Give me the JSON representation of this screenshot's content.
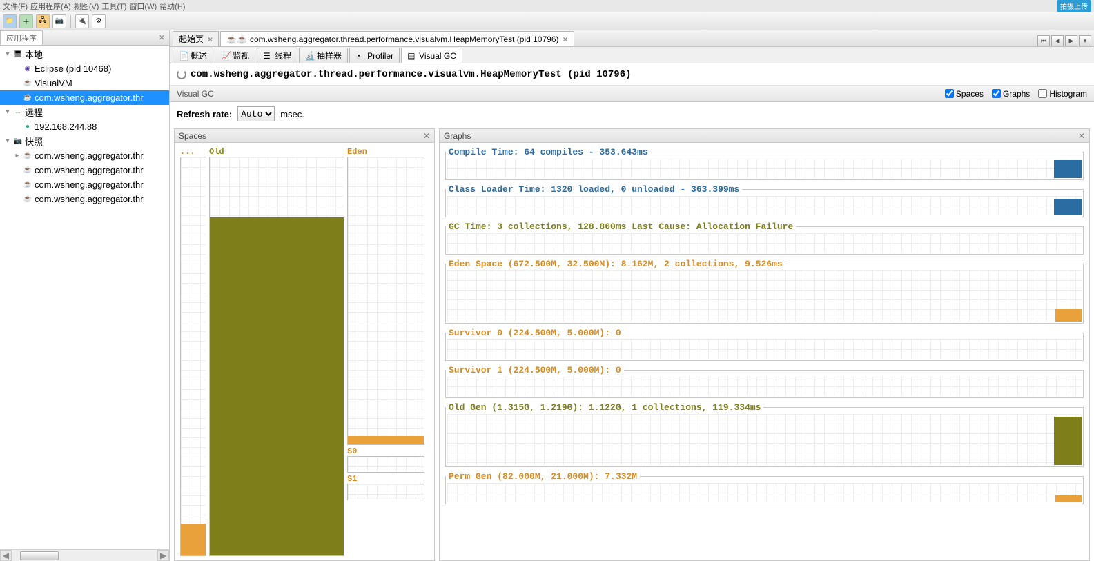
{
  "menu": {
    "items": [
      "文件(F)",
      "应用程序(A)",
      "视图(V)",
      "工具(T)",
      "窗口(W)",
      "帮助(H)"
    ]
  },
  "badge": "拍摄上传",
  "left_panel": {
    "tab": "应用程序",
    "close": "✕"
  },
  "tree": {
    "local": "本地",
    "eclipse": "Eclipse (pid 10468)",
    "visualvm": "VisualVM",
    "selected": "com.wsheng.aggregator.thr",
    "remote": "远程",
    "host": "192.168.244.88",
    "snapshot": "快照",
    "snap1": "com.wsheng.aggregator.thr",
    "snap2": "com.wsheng.aggregator.thr",
    "snap3": "com.wsheng.aggregator.thr",
    "snap4": "com.wsheng.aggregator.thr"
  },
  "top_tabs": {
    "start": "起始页",
    "main": "com.wsheng.aggregator.thread.performance.visualvm.HeapMemoryTest (pid 10796)"
  },
  "sub_tabs": {
    "overview": "概述",
    "monitor": "监视",
    "threads": "线程",
    "sampler": "抽样器",
    "profiler": "Profiler",
    "visualgc": "Visual GC"
  },
  "process_title": "com.wsheng.aggregator.thread.performance.visualvm.HeapMemoryTest (pid 10796)",
  "section_label": "Visual GC",
  "checkboxes": {
    "spaces": "Spaces",
    "graphs": "Graphs",
    "histogram": "Histogram"
  },
  "refresh": {
    "label": "Refresh rate:",
    "value": "Auto",
    "unit": "msec."
  },
  "spaces_panel": {
    "title": "Spaces",
    "cols": {
      "dots": "...",
      "old": "Old",
      "eden": "Eden",
      "s0": "S0",
      "s1": "S1"
    }
  },
  "graphs_panel": {
    "title": "Graphs",
    "items": {
      "compile": "Compile Time: 64 compiles - 353.643ms",
      "classloader": "Class Loader Time: 1320 loaded, 0 unloaded - 363.399ms",
      "gc": "GC Time: 3 collections, 128.860ms Last Cause: Allocation Failure",
      "eden": "Eden Space (672.500M, 32.500M): 8.162M, 2 collections, 9.526ms",
      "s0": "Survivor 0 (224.500M, 5.000M): 0",
      "s1": "Survivor 1 (224.500M, 5.000M): 0",
      "old": "Old Gen (1.315G, 1.219G): 1.122G, 1 collections, 119.334ms",
      "perm": "Perm Gen (82.000M, 21.000M): 7.332M"
    }
  },
  "chart_data": {
    "spaces": [
      {
        "name": "Perm",
        "fill_pct": 8,
        "color": "#e9a23b"
      },
      {
        "name": "Old",
        "capacity_g": 1.315,
        "used_g": 1.122,
        "fill_pct": 85,
        "color": "#7e7e1a"
      },
      {
        "name": "Eden",
        "capacity_m": 672.5,
        "used_m": 8.162,
        "fill_pct": 3,
        "color": "#e9a23b"
      },
      {
        "name": "S0",
        "capacity_m": 224.5,
        "used": 0,
        "fill_pct": 0
      },
      {
        "name": "S1",
        "capacity_m": 224.5,
        "used": 0,
        "fill_pct": 0
      }
    ],
    "graphs": [
      {
        "metric": "Compile Time",
        "compiles": 64,
        "time_ms": 353.643,
        "color": "#2b6ca3"
      },
      {
        "metric": "Class Loader Time",
        "loaded": 1320,
        "unloaded": 0,
        "time_ms": 363.399,
        "color": "#2b6ca3"
      },
      {
        "metric": "GC Time",
        "collections": 3,
        "time_ms": 128.86,
        "last_cause": "Allocation Failure",
        "color": "#7e7e1a"
      },
      {
        "metric": "Eden Space",
        "max_m": 672.5,
        "committed_m": 32.5,
        "used_m": 8.162,
        "collections": 2,
        "time_ms": 9.526,
        "color": "#d98c20"
      },
      {
        "metric": "Survivor 0",
        "max_m": 224.5,
        "committed_m": 5.0,
        "used": 0,
        "color": "#d98c20"
      },
      {
        "metric": "Survivor 1",
        "max_m": 224.5,
        "committed_m": 5.0,
        "used": 0,
        "color": "#d98c20"
      },
      {
        "metric": "Old Gen",
        "max_g": 1.315,
        "committed_g": 1.219,
        "used_g": 1.122,
        "collections": 1,
        "time_ms": 119.334,
        "color": "#7e7e1a"
      },
      {
        "metric": "Perm Gen",
        "max_m": 82.0,
        "committed_m": 21.0,
        "used_m": 7.332,
        "color": "#d98c20"
      }
    ]
  }
}
